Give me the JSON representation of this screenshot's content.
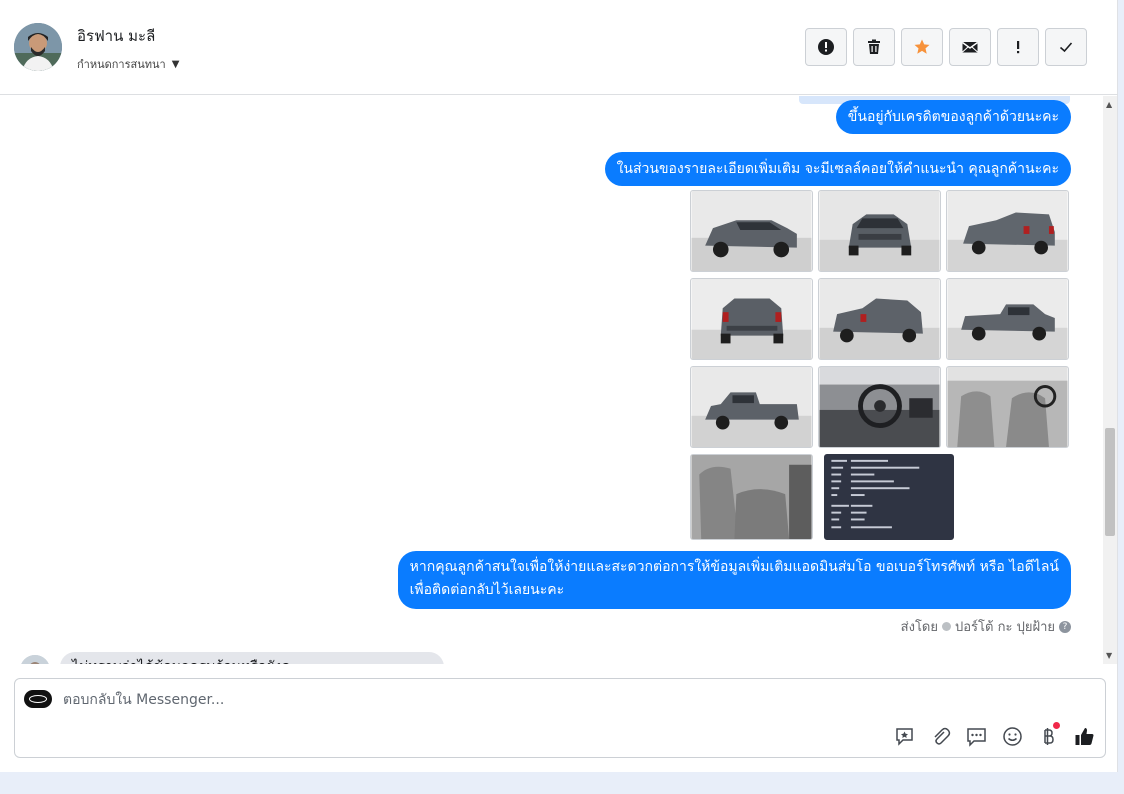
{
  "header": {
    "contact_name": "อิรฟาน มะลี",
    "assign_label": "กำหนดการสนทนา",
    "actions": [
      {
        "icon": "alert-circle-icon",
        "name": "spam-button"
      },
      {
        "icon": "trash-icon",
        "name": "delete-button"
      },
      {
        "icon": "star-icon",
        "name": "star-button"
      },
      {
        "icon": "envelope-icon",
        "name": "mark-unread-button"
      },
      {
        "icon": "exclamation-icon",
        "name": "follow-up-button"
      },
      {
        "icon": "check-icon",
        "name": "mark-done-button"
      }
    ],
    "star_color": "#f7923b"
  },
  "messages": {
    "msg1": "ขึ้นอยู่กับเครดิตของลูกค้าด้วยนะคะ",
    "msg2": "ในส่วนของรายละเอียดเพิ่มเติม จะมีเซลล์คอยให้คำแนะนำ คุณลูกค้านะคะ",
    "msg3_line1": "หากคุณลูกค้าสนใจเพื่อให้ง่ายและสะดวกต่อการให้ข้อมูลเพิ่มเติมแอดมินส่มโอ ขอเบอร์โทรศัพท์ หรือ ไอดีไลน์",
    "msg3_line2": "เพื่อติดต่อกลับไว้เลยนะคะ",
    "sent_by_label": "ส่งโดย",
    "sender_name": "ปอร์โต้ กะ ปุยฝ้าย",
    "incoming_partial": "ไม่ทราบว่าได้ข้อมูลครบถ้วนหรือยังคะ"
  },
  "gallery": {
    "photos": [
      {
        "name": "photo-front-left"
      },
      {
        "name": "photo-front"
      },
      {
        "name": "photo-rear-right"
      },
      {
        "name": "photo-rear"
      },
      {
        "name": "photo-rear-left"
      },
      {
        "name": "photo-side-right"
      },
      {
        "name": "photo-side-left"
      },
      {
        "name": "photo-dashboard"
      },
      {
        "name": "photo-front-seats"
      },
      {
        "name": "photo-rear-seats"
      },
      {
        "name": "photo-spec-sheet"
      }
    ]
  },
  "composer": {
    "placeholder": "ตอบกลับใน Messenger...",
    "tools": [
      "saved-reply-icon",
      "attachment-icon",
      "chat-bubbles-icon",
      "emoji-icon",
      "baht-payment-icon",
      "like-icon"
    ]
  },
  "colors": {
    "accent": "#0a7cff",
    "notification_dot": "#f02849"
  }
}
